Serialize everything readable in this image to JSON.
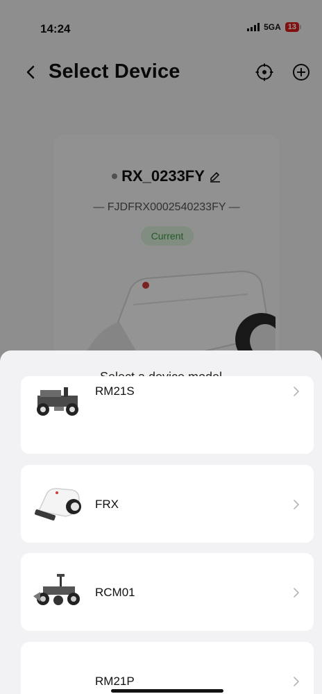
{
  "status_bar": {
    "time": "14:24",
    "network": "5GA",
    "battery": "13"
  },
  "header": {
    "title": "Select Device",
    "back_icon": "chevron-left-icon",
    "locate_icon": "crosshair-icon",
    "add_icon": "plus-circle-icon"
  },
  "current_device": {
    "name": "RX_0233FY",
    "serial": "— FJDFRX0002540233FY —",
    "badge": "Current"
  },
  "sheet": {
    "title": "Select a device model",
    "models": [
      {
        "label": "RM21S"
      },
      {
        "label": "FRX"
      },
      {
        "label": "RCM01"
      },
      {
        "label": "RM21P"
      }
    ]
  },
  "colors": {
    "badge_bg": "#dff3df",
    "badge_text": "#3d9a47",
    "battery_low": "#e11d1d",
    "sheet_bg": "#f2f2f4",
    "card_bg": "#ffffff"
  }
}
